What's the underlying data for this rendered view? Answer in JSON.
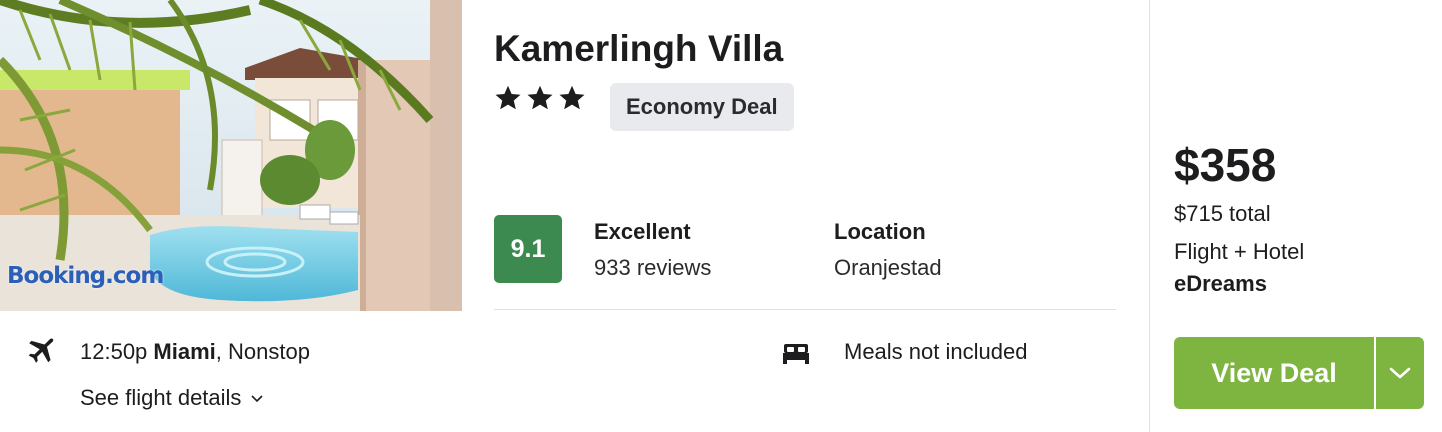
{
  "photo": {
    "watermark": "Booking.com",
    "colors": {
      "sky": "#dfe9ef",
      "pool": "#7fd3e8",
      "palm": "#6f8e2e",
      "wall": "#e8d6c4"
    }
  },
  "hotel": {
    "name": "Kamerlingh Villa",
    "stars": 3,
    "deal_badge": "Economy Deal"
  },
  "rating": {
    "score": "9.1",
    "label": "Excellent",
    "reviews": "933 reviews",
    "score_color": "#3d8a50"
  },
  "location": {
    "label": "Location",
    "value": "Oranjestad"
  },
  "flight": {
    "icon": "plane-icon",
    "time": "12:50p",
    "origin": "Miami",
    "stops": ", Nonstop",
    "details_link": "See flight details",
    "details_icon": "chevron-down-icon"
  },
  "amenities": {
    "icon": "bed-icon",
    "meals": "Meals not included"
  },
  "pricing": {
    "price": "$358",
    "total": "$715 total",
    "package": "Flight + Hotel",
    "provider": "eDreams",
    "button_label": "View Deal",
    "button_color": "#7eb541"
  }
}
